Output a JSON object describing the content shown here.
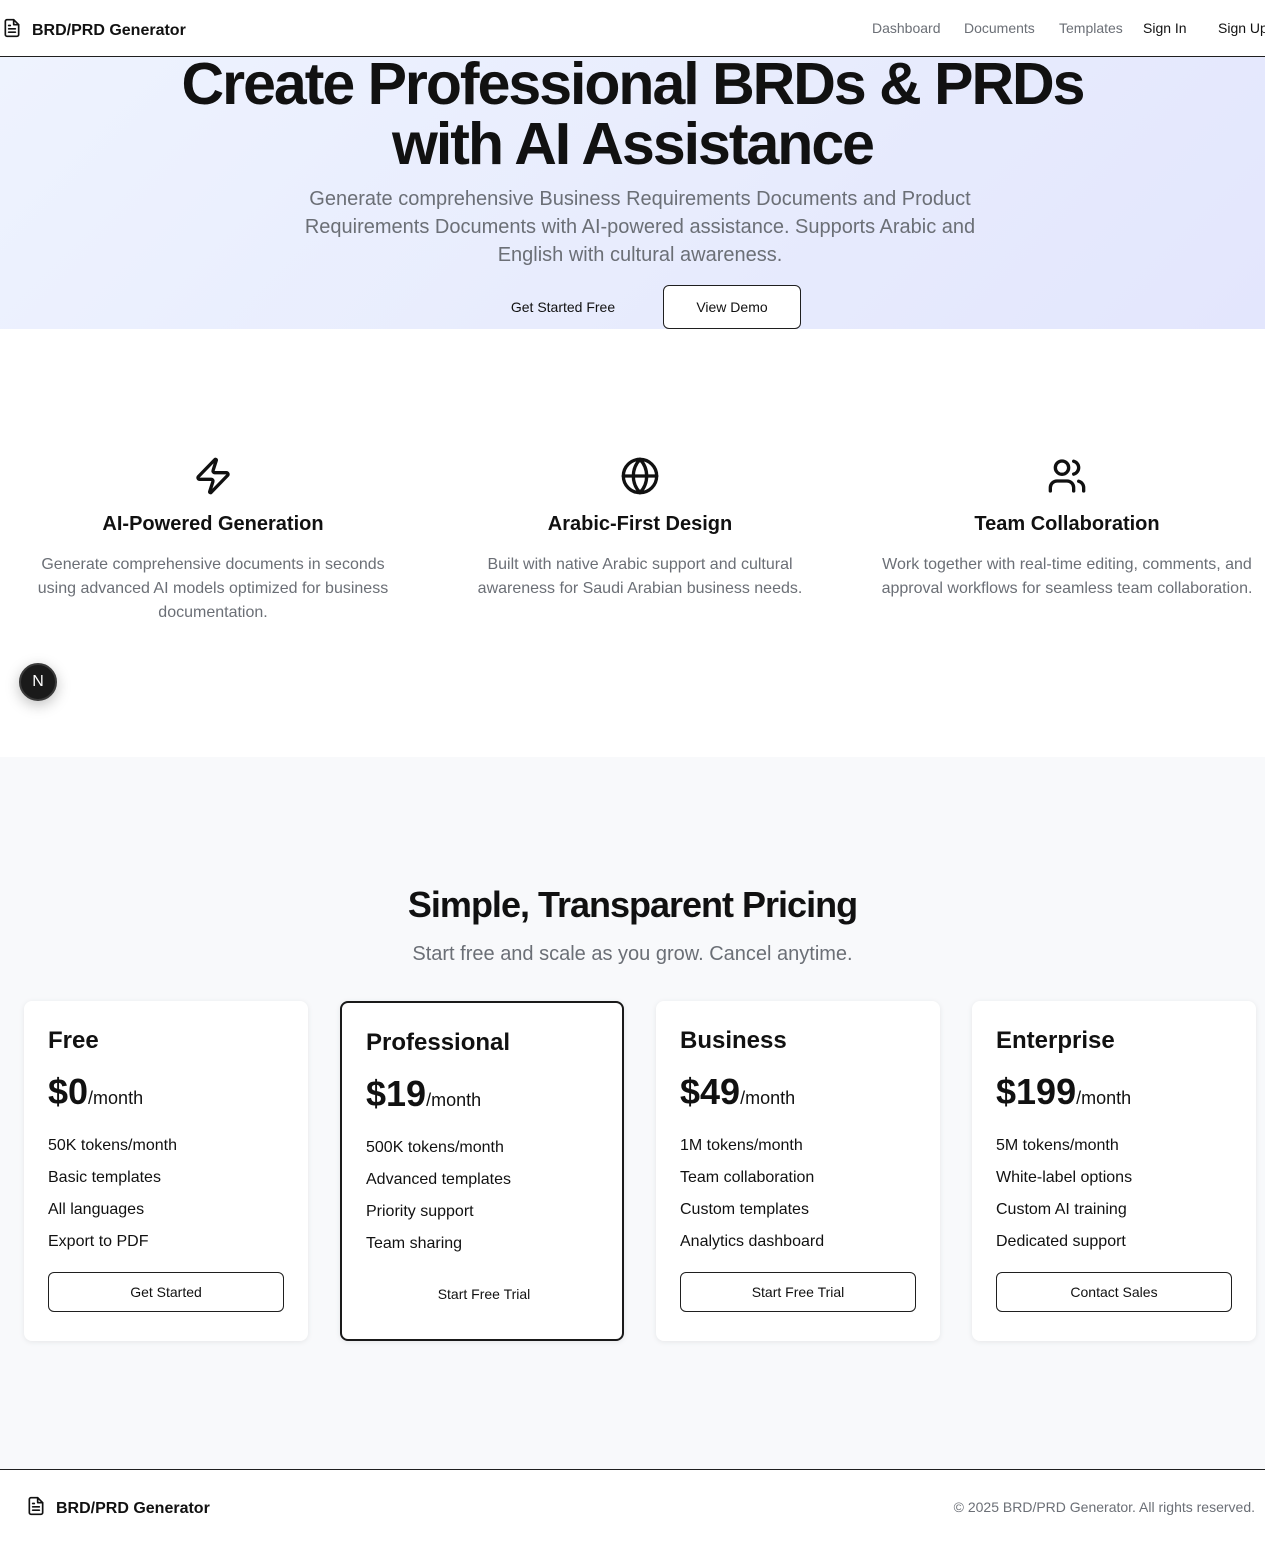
{
  "header": {
    "brand": "BRD/PRD Generator",
    "brand_icon": "file-text-icon",
    "nav": {
      "dashboard": "Dashboard",
      "documents": "Documents",
      "templates": "Templates",
      "sign_in": "Sign In",
      "sign_up": "Sign Up"
    }
  },
  "hero": {
    "title_line1": "Create Professional BRDs & PRDs",
    "title_line2": "with AI Assistance",
    "subtitle": "Generate comprehensive Business Requirements Documents and Product Requirements Documents with AI-powered assistance. Supports Arabic and English with cultural awareness.",
    "cta_primary": "Get Started Free",
    "cta_secondary": "View Demo"
  },
  "features": [
    {
      "icon": "zap-icon",
      "title": "AI-Powered Generation",
      "description": "Generate comprehensive documents in seconds using advanced AI models optimized for business documentation."
    },
    {
      "icon": "globe-icon",
      "title": "Arabic-First Design",
      "description": "Built with native Arabic support and cultural awareness for Saudi Arabian business needs."
    },
    {
      "icon": "users-icon",
      "title": "Team Collaboration",
      "description": "Work together with real-time editing, comments, and approval workflows for seamless team collaboration."
    }
  ],
  "badge": {
    "label": "N",
    "icon": "nextjs-badge-icon"
  },
  "pricing": {
    "title": "Simple, Transparent Pricing",
    "subtitle": "Start free and scale as you grow. Cancel anytime.",
    "plans": [
      {
        "name": "Free",
        "price": "$0",
        "unit": "/month",
        "features": [
          "50K tokens/month",
          "Basic templates",
          "All languages",
          "Export to PDF"
        ],
        "cta": "Get Started",
        "featured": false
      },
      {
        "name": "Professional",
        "price": "$19",
        "unit": "/month",
        "features": [
          "500K tokens/month",
          "Advanced templates",
          "Priority support",
          "Team sharing"
        ],
        "cta": "Start Free Trial",
        "featured": true
      },
      {
        "name": "Business",
        "price": "$49",
        "unit": "/month",
        "features": [
          "1M tokens/month",
          "Team collaboration",
          "Custom templates",
          "Analytics dashboard"
        ],
        "cta": "Start Free Trial",
        "featured": false
      },
      {
        "name": "Enterprise",
        "price": "$199",
        "unit": "/month",
        "features": [
          "5M tokens/month",
          "White-label options",
          "Custom AI training",
          "Dedicated support"
        ],
        "cta": "Contact Sales",
        "featured": false
      }
    ]
  },
  "footer": {
    "brand": "BRD/PRD Generator",
    "copyright": "© 2025 BRD/PRD Generator. All rights reserved."
  },
  "colors": {
    "text": "#111111",
    "muted": "#6b6f76",
    "hero_bg_start": "#eef3fe",
    "hero_bg_end": "#e3e6fd",
    "pricing_bg": "#f8f9fb",
    "border": "#1f1f1f"
  }
}
